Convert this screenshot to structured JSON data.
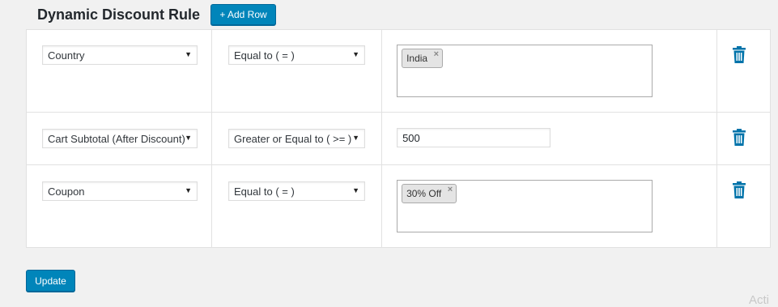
{
  "header": {
    "title": "Dynamic Discount Rule",
    "add_row_label": "+ Add Row"
  },
  "rows": [
    {
      "field": "Country",
      "operator": "Equal to ( = )",
      "value_type": "tags",
      "tags": [
        "India"
      ],
      "value": ""
    },
    {
      "field": "Cart Subtotal (After Discount)",
      "operator": "Greater or Equal to ( >= )",
      "value_type": "text",
      "tags": [],
      "value": "500"
    },
    {
      "field": "Coupon",
      "operator": "Equal to ( = )",
      "value_type": "tags",
      "tags": [
        "30% Off"
      ],
      "value": ""
    }
  ],
  "footer": {
    "update_label": "Update"
  },
  "icons": {
    "dropdown": "caret-down-icon",
    "remove_tag": "close-icon",
    "delete_row": "trash-icon"
  },
  "colors": {
    "primary": "#0085ba",
    "trash": "#0073aa",
    "background": "#f1f1f1"
  },
  "watermark": "Acti"
}
